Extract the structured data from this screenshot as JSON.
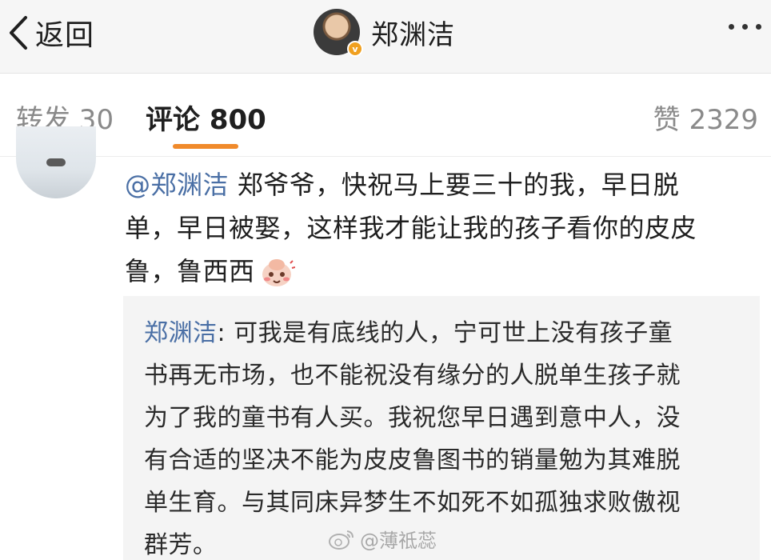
{
  "nav": {
    "back_label": "返回",
    "profile_name": "郑渊洁",
    "verified_badge": "v"
  },
  "tabs": {
    "repost": "转发 30",
    "comment": "评论 800",
    "like": "赞 2329",
    "active": "comment",
    "accent_color": "#f08a2b"
  },
  "comment": {
    "mention": "@郑渊洁",
    "text_line1": " 郑爷爷，快祝马上要三十的我，早日脱",
    "text_line2": "单，早日被娶，这样我才能让我的孩子看你的皮皮",
    "text_line3": "鲁，鲁西西",
    "emoji": "cute-emoji"
  },
  "reply": {
    "author": "郑渊洁",
    "line1": ": 可我是有底线的人，宁可世上没有孩子童",
    "line2": "书再无市场，也不能祝没有缘分的人脱单生孩子就",
    "line3": "为了我的童书有人买。我祝您早日遇到意中人，没",
    "line4": "有合适的坚决不能为皮皮鲁图书的销量勉为其难脱",
    "line5": "单生育。与其同床异梦生不如死不如孤独求败傲视",
    "line6": "群芳。"
  },
  "watermark": {
    "text": "@薄祗蕊"
  },
  "colors": {
    "link": "#4a6fa5",
    "reply_bg": "#f4f4f4",
    "navbar_bg": "#f6f6f6"
  }
}
